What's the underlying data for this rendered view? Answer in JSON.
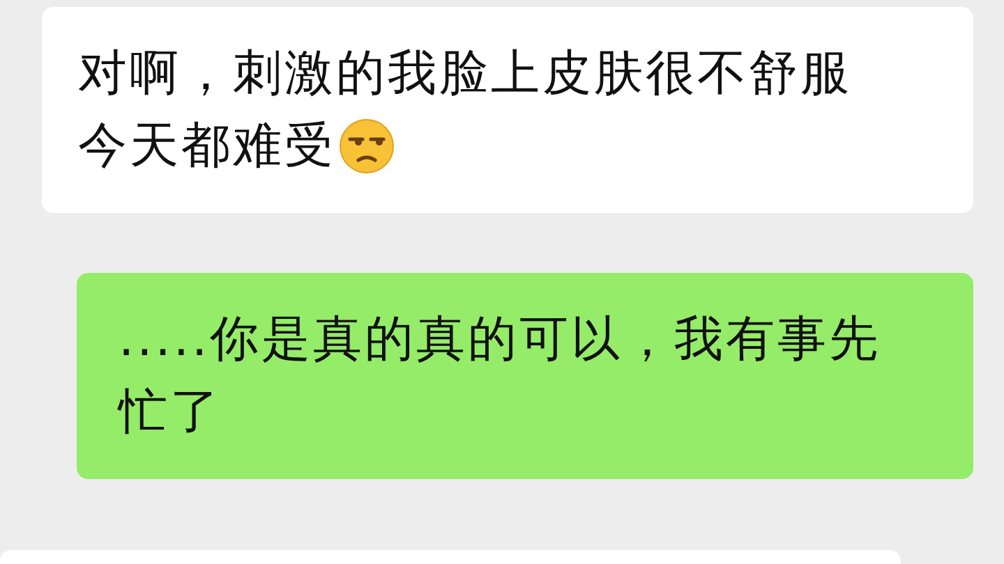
{
  "messages": [
    {
      "kind": "received",
      "lines": [
        {
          "text": "对啊，刺激的我脸上皮肤很不舒服",
          "emoji": false
        },
        {
          "text": "今天都难受",
          "emoji": true
        }
      ]
    },
    {
      "kind": "sent",
      "lines": [
        {
          "text": ".....你是真的真的可以，我有事先",
          "emoji": false
        },
        {
          "text": "忙了",
          "emoji": false
        }
      ]
    },
    {
      "kind": "received"
    }
  ]
}
